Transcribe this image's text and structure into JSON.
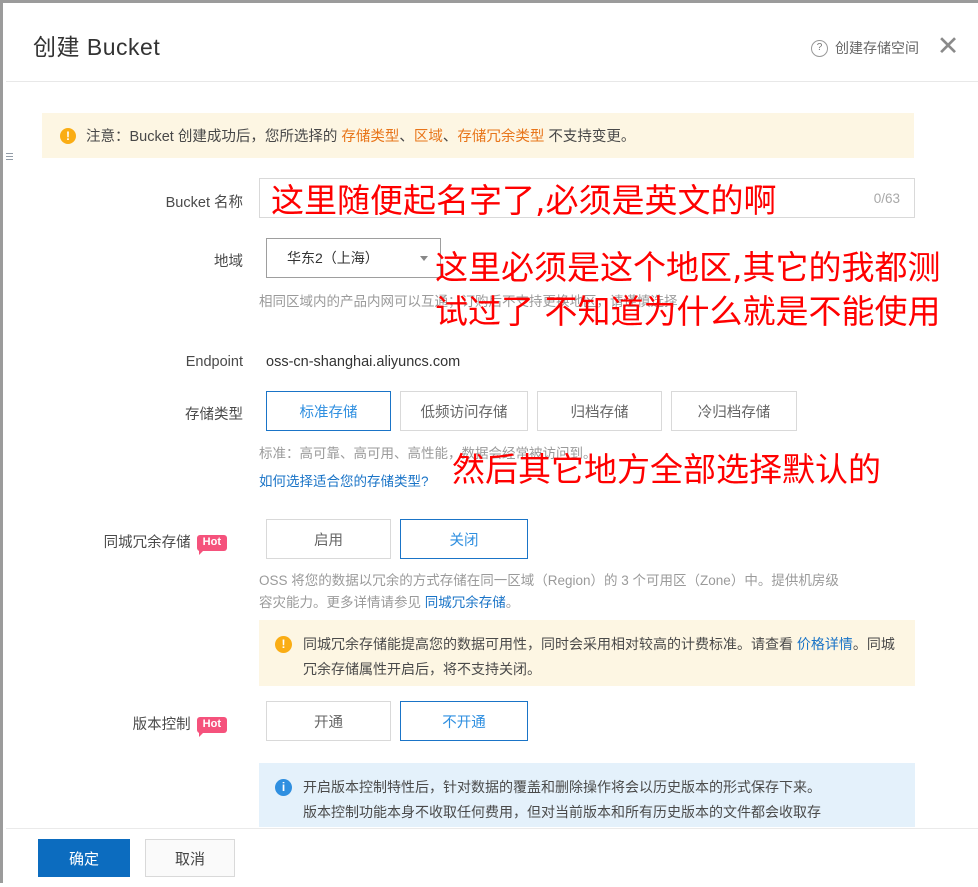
{
  "header": {
    "title": "创建 Bucket",
    "help_label": "创建存储空间",
    "help_icon": "question-circle-icon",
    "close_icon": "close-icon"
  },
  "warning_banner": {
    "icon": "exclamation-icon",
    "prefix": "注意：Bucket 创建成功后，您所选择的 ",
    "emphasis1": "存储类型",
    "sep1": "、",
    "emphasis2": "区域",
    "sep2": "、",
    "emphasis3": "存储冗余类型",
    "suffix": " 不支持变更。"
  },
  "form": {
    "bucket_name": {
      "label": "Bucket 名称",
      "value": "",
      "placeholder": "",
      "counter": "0/63"
    },
    "region": {
      "label": "地域",
      "value": "华东2（上海）",
      "hint": "相同区域内的产品内网可以互通；订购后不支持更换地区，请谨慎选择"
    },
    "endpoint": {
      "label": "Endpoint",
      "value": "oss-cn-shanghai.aliyuncs.com"
    },
    "storage_class": {
      "label": "存储类型",
      "options": [
        "标准存储",
        "低频访问存储",
        "归档存储",
        "冷归档存储"
      ],
      "selected": "标准存储",
      "hint": "标准：高可靠、高可用、高性能，数据会经常被访问到。",
      "link": "如何选择适合您的存储类型?"
    },
    "zone_redundancy": {
      "label": "同城冗余存储",
      "badge": "Hot",
      "options": [
        "启用",
        "关闭"
      ],
      "selected": "关闭",
      "desc_line1": "OSS 将您的数据以冗余的方式存储在同一区域（Region）的 3 个可用区（Zone）中。提供机房级",
      "desc_line2_pre": "容灾能力。更多详情请参见 ",
      "desc_link": "同城冗余存储",
      "desc_line2_post": "。",
      "note": {
        "icon": "exclamation-icon",
        "text_pre": "同城冗余存储能提高您的数据可用性，同时会采用相对较高的计费标准。请查看 ",
        "link": "价格详情",
        "text_post": "。同城冗余存储属性开启后，将不支持关闭。"
      }
    },
    "versioning": {
      "label": "版本控制",
      "badge": "Hot",
      "options": [
        "开通",
        "不开通"
      ],
      "selected": "不开通",
      "note": {
        "icon": "info-icon",
        "line1": "开启版本控制特性后，针对数据的覆盖和删除操作将会以历史版本的形式保存下来。",
        "line2": "版本控制功能本身不收取任何费用，但对当前版本和所有历史版本的文件都会收取存"
      }
    }
  },
  "footer": {
    "confirm": "确定",
    "cancel": "取消"
  },
  "annotations": [
    "这里随便起名字了,必须是英文的啊",
    "这里必须是这个地区,其它的我都测",
    "试过了 不知道为什么就是不能使用",
    "然后其它地方全部选择默认的"
  ],
  "colors": {
    "accent": "#1a74c7",
    "primary_button": "#0c6cbf",
    "warning_bg": "#fdf6e3",
    "warning_icon": "#faad14",
    "info_bg": "#e4f1fb",
    "hot_badge": "#f5527c",
    "annotation": "#ff0000",
    "emphasis_text": "#e8751a"
  }
}
